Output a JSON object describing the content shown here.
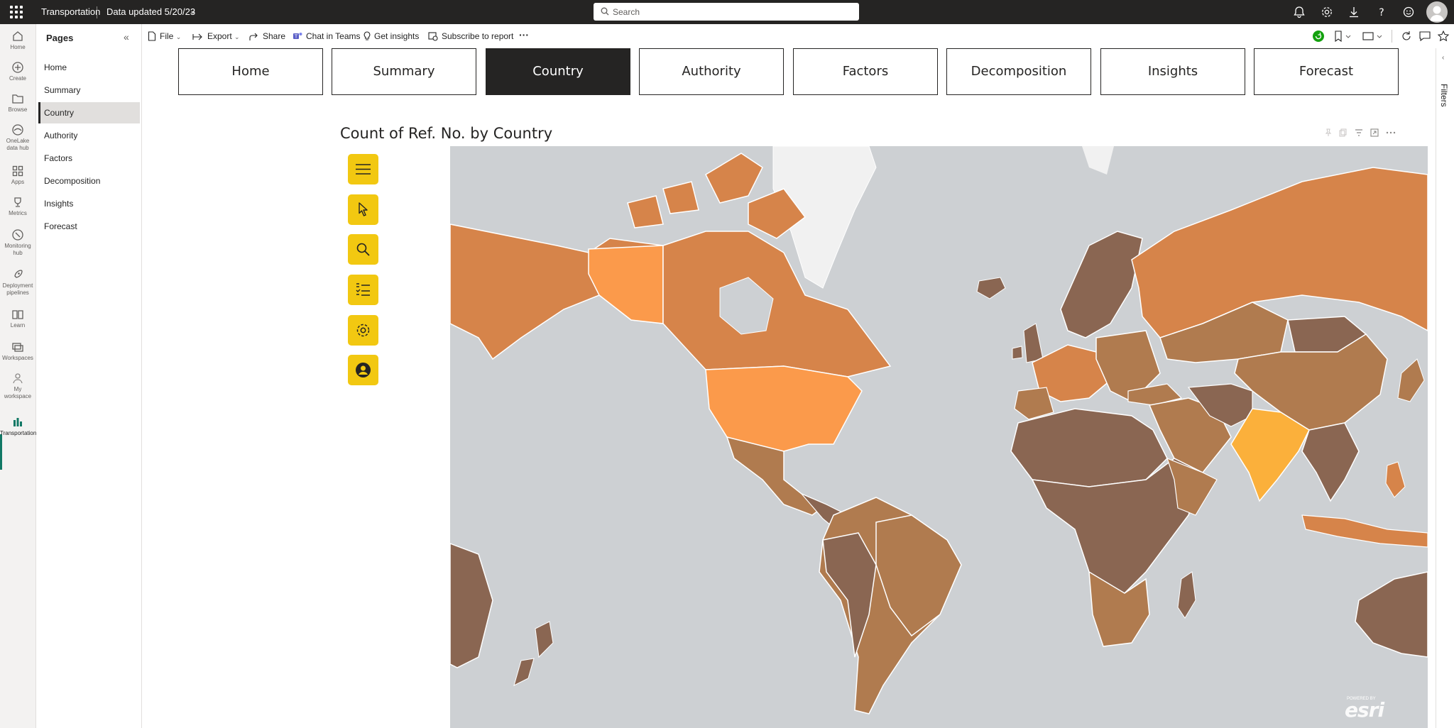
{
  "topbar": {
    "app_title": "Transportation",
    "data_updated": "Data updated 5/20/23",
    "search_placeholder": "Search"
  },
  "rail": {
    "items": [
      {
        "label": "Home",
        "icon": "home-icon"
      },
      {
        "label": "Create",
        "icon": "plus-circle-icon"
      },
      {
        "label": "Browse",
        "icon": "folder-icon"
      },
      {
        "label": "OneLake data hub",
        "icon": "onelake-icon"
      },
      {
        "label": "Apps",
        "icon": "apps-icon"
      },
      {
        "label": "Metrics",
        "icon": "trophy-icon"
      },
      {
        "label": "Monitoring hub",
        "icon": "monitor-icon"
      },
      {
        "label": "Deployment pipelines",
        "icon": "rocket-icon"
      },
      {
        "label": "Learn",
        "icon": "book-icon"
      },
      {
        "label": "Workspaces",
        "icon": "workspaces-icon"
      },
      {
        "label": "My workspace",
        "icon": "person-icon"
      },
      {
        "label": "Transportation",
        "icon": "report-icon"
      }
    ]
  },
  "pages": {
    "title": "Pages",
    "items": [
      "Home",
      "Summary",
      "Country",
      "Authority",
      "Factors",
      "Decomposition",
      "Insights",
      "Forecast"
    ],
    "active": "Country"
  },
  "actionbar": {
    "file": "File",
    "export": "Export",
    "share": "Share",
    "chat": "Chat in Teams",
    "insights": "Get insights",
    "subscribe": "Subscribe to report",
    "more": "···"
  },
  "report_nav": {
    "buttons": [
      "Home",
      "Summary",
      "Country",
      "Authority",
      "Factors",
      "Decomposition",
      "Insights",
      "Forecast"
    ],
    "active": "Country"
  },
  "visual": {
    "title": "Count of Ref. No. by Country",
    "tools": [
      "menu-icon",
      "pointer-icon",
      "search-icon",
      "legend-list-icon",
      "settings-icon",
      "user-icon"
    ],
    "attribution": "esri",
    "attribution_small": "POWERED BY"
  },
  "filters": {
    "label": "Filters"
  },
  "colors": {
    "topbar": "#252423",
    "accent_yellow": "#f2c811",
    "map_ocean": "#cdd0d3",
    "country_low": "#8a6652",
    "country_mid": "#b07b4f",
    "country_high": "#d6844a",
    "country_top": "#fb9a4b",
    "country_max": "#fbb03b",
    "greenland": "#f1f1f1"
  }
}
